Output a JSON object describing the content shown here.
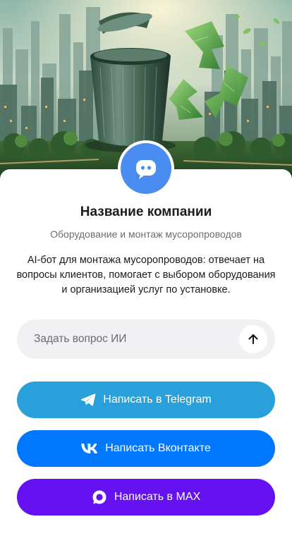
{
  "hero": {
    "image_name": "recycling-bin-city-illustration"
  },
  "company": {
    "avatar_icon": "chat-bot-icon",
    "name": "Название компании",
    "subtitle": "Оборудование и монтаж мусоропроводов",
    "description": "AI-бот для монтажа мусоропроводов: отвечает на вопросы клиентов, помогает с выбором оборудования и организацией услуг по установке."
  },
  "ask": {
    "placeholder": "Задать вопрос ИИ",
    "value": "",
    "send_icon": "arrow-up-icon"
  },
  "buttons": [
    {
      "label": "Написать в Telegram",
      "icon": "telegram-icon",
      "color": "#2aa0da"
    },
    {
      "label": "Написать Вконтакте",
      "icon": "vk-icon",
      "color": "#0077ff"
    },
    {
      "label": "Написать в MAX",
      "icon": "max-icon",
      "color": "#6511f2"
    }
  ],
  "colors": {
    "avatar": "#4a8cf0",
    "input_background": "#f1f1f3"
  }
}
